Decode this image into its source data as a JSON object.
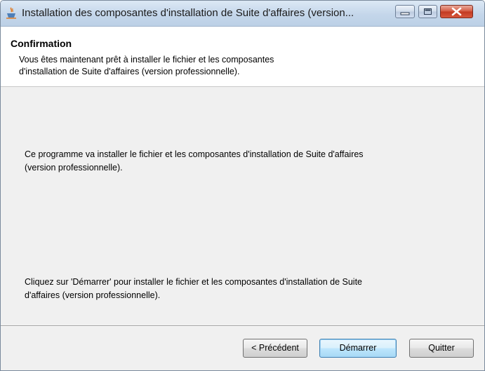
{
  "window": {
    "title": "Installation des composantes d'installation de Suite d'affaires (version..."
  },
  "header": {
    "title": "Confirmation",
    "description_line1": "Vous êtes maintenant prêt à installer le fichier et les composantes",
    "description_line2": "d'installation de Suite d'affaires (version professionnelle)."
  },
  "body": {
    "message1_line1": "Ce programme va installer le fichier et les composantes d'installation de Suite d'affaires",
    "message1_line2": "(version professionnelle).",
    "message2_line1": "Cliquez sur 'Démarrer' pour installer le fichier et les composantes d'installation de Suite",
    "message2_line2": "d'affaires (version professionnelle)."
  },
  "buttons": {
    "previous": "< Précédent",
    "start": "Démarrer",
    "quit": "Quitter"
  },
  "icons": {
    "app": "java-cup-icon",
    "minimize": "minimize-icon",
    "maximize": "maximize-icon",
    "close": "close-icon"
  }
}
